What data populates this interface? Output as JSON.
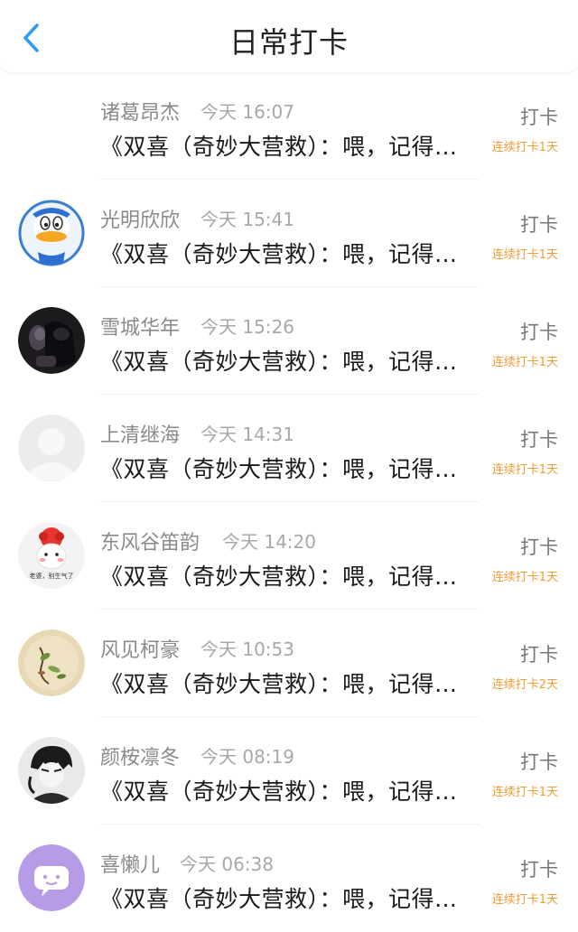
{
  "header": {
    "title": "日常打卡"
  },
  "checkins": [
    {
      "name": "诸葛昂杰",
      "time": "今天 16:07",
      "message": "《双喜（奇妙大营救）：喂，记得…",
      "action": "打卡",
      "streak": "连续打卡1天",
      "avatar": "none"
    },
    {
      "name": "光明欣欣",
      "time": "今天 15:41",
      "message": "《双喜（奇妙大营救）：喂，记得…",
      "action": "打卡",
      "streak": "连续打卡1天",
      "avatar": "duck"
    },
    {
      "name": "雪城华年",
      "time": "今天 15:26",
      "message": "《双喜（奇妙大营救）：喂，记得…",
      "action": "打卡",
      "streak": "连续打卡1天",
      "avatar": "dark-photo"
    },
    {
      "name": "上清继海",
      "time": "今天 14:31",
      "message": "《双喜（奇妙大营救）：喂，记得…",
      "action": "打卡",
      "streak": "连续打卡1天",
      "avatar": "default"
    },
    {
      "name": "东风谷笛韵",
      "time": "今天 14:20",
      "message": "《双喜（奇妙大营救）：喂，记得…",
      "action": "打卡",
      "streak": "连续打卡1天",
      "avatar": "cartoon"
    },
    {
      "name": "风见柯豪",
      "time": "今天 10:53",
      "message": "《双喜（奇妙大营救）：喂，记得…",
      "action": "打卡",
      "streak": "连续打卡2天",
      "avatar": "painting"
    },
    {
      "name": "颜桉凛冬",
      "time": "今天 08:19",
      "message": "《双喜（奇妙大营救）：喂，记得…",
      "action": "打卡",
      "streak": "连续打卡1天",
      "avatar": "anime"
    },
    {
      "name": "喜懒儿",
      "time": "今天 06:38",
      "message": "《双喜（奇妙大营救）：喂，记得…",
      "action": "打卡",
      "streak": "连续打卡1天",
      "avatar": "purple"
    }
  ],
  "avatar5_text": "老婆，别生气了"
}
